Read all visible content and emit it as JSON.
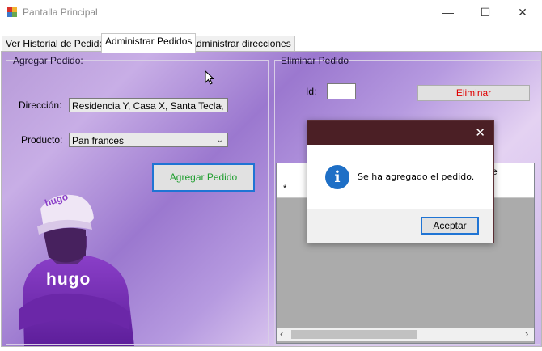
{
  "window": {
    "title": "Pantalla Principal",
    "minimize_glyph": "—",
    "maximize_glyph": "☐",
    "close_glyph": "✕"
  },
  "tabs": [
    {
      "label": "Ver Historial de Pedidos",
      "active": false
    },
    {
      "label": "Administrar Pedidos",
      "active": true
    },
    {
      "label": "Administrar direcciones",
      "active": false
    }
  ],
  "agregar": {
    "group_title": "Agregar Pedido:",
    "direccion_label": "Dirección:",
    "direccion_value": "Residencia Y, Casa X, Santa Tecla,",
    "producto_label": "Producto:",
    "producto_value": "Pan frances",
    "button_label": "Agregar Pedido",
    "button_color": "#1e9e2e",
    "logo_text": "hugo",
    "cap_text": "hugo"
  },
  "eliminar": {
    "group_title": "Eliminar Pedido",
    "id_label": "Id:",
    "id_value": "",
    "button_label": "Eliminar",
    "button_color": "#e00000",
    "grid_header_partial": "e",
    "new_row_marker": "*"
  },
  "dialog": {
    "message": "Se ha agregado el pedido.",
    "ok_label": "Aceptar",
    "close_glyph": "✕",
    "icon": "info-icon",
    "icon_glyph": "i",
    "title_bar_color": "#4b1f25",
    "icon_color": "#1e6fc6"
  },
  "scrollbar": {
    "left_arrow": "‹",
    "right_arrow": "›"
  }
}
